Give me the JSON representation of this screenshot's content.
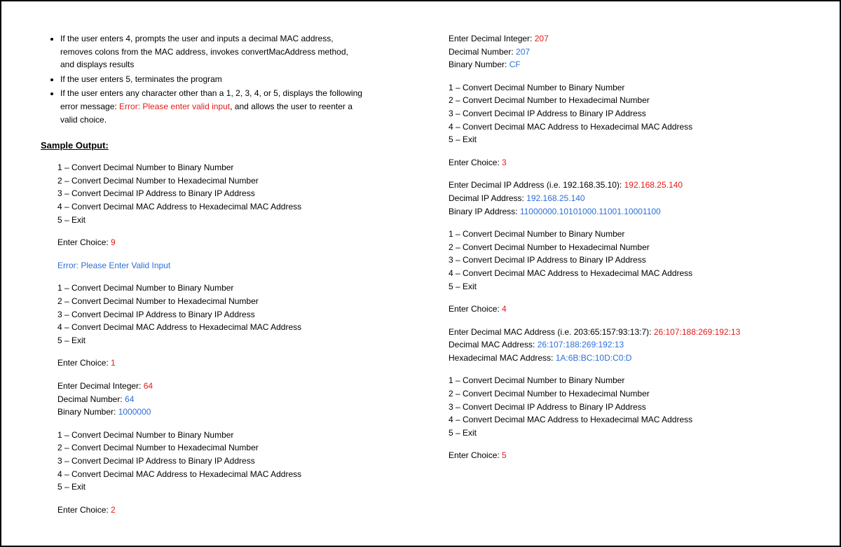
{
  "bullets": {
    "b1a": "If the user enters 4, prompts the user and inputs a decimal MAC address,",
    "b1b": "removes colons from the MAC address, invokes convertMacAddress method,",
    "b1c": "and displays results",
    "b2": "If the user enters 5, terminates the program",
    "b3a": "If the user enters any character other than a 1, 2, 3, 4, or 5, displays the following",
    "b3b_pre": "error message: ",
    "b3b_err": "Error: Please enter valid input",
    "b3b_post": ", and allows the user to reenter a",
    "b3c": "valid choice."
  },
  "heading": "Sample Output:",
  "menu": {
    "m1": "1 – Convert Decimal Number to Binary Number",
    "m2": "2 – Convert Decimal Number to Hexadecimal Number",
    "m3": "3 – Convert Decimal IP Address to Binary IP Address",
    "m4": "4 – Convert Decimal MAC Address to Hexadecimal MAC Address",
    "m5": "5 – Exit"
  },
  "labels": {
    "enterChoice": "Enter Choice: ",
    "errorInput": "Error: Please Enter Valid Input",
    "enterDecInt": "Enter Decimal Integer: ",
    "decNum": "Decimal Number: ",
    "binNum": "Binary Number: ",
    "enterDecIP": "Enter Decimal IP Address (i.e. 192.168.35.10): ",
    "decIP": "Decimal IP Address: ",
    "binIP": "Binary IP Address: ",
    "enterDecMAC": "Enter Decimal MAC Address (i.e. 203:65:157:93:13:7): ",
    "decMAC": "Decimal MAC Address: ",
    "hexMAC": "Hexadecimal MAC Address: "
  },
  "vals": {
    "choice9": "9",
    "choice1": "1",
    "int64": "64",
    "dec64": "64",
    "bin64": "1000000",
    "choice2": "2",
    "int207": "207",
    "dec207": "207",
    "hex207": "CF",
    "choice3": "3",
    "ipIn": "192.168.25.140",
    "ipDec": "192.168.25.140",
    "ipBin": "11000000.10101000.11001.10001100",
    "choice4": "4",
    "macIn": "26:107:188:269:192:13",
    "macDec": "26:107:188:269:192:13",
    "macHex": "1A:6B:BC:10D:C0:D",
    "choice5": "5"
  }
}
